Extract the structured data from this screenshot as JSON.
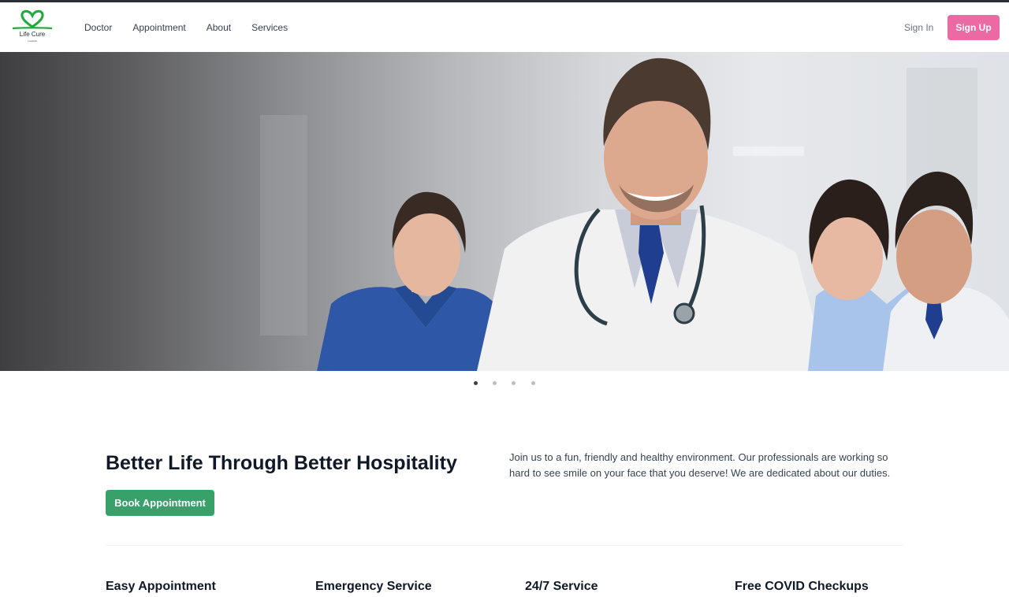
{
  "brand": {
    "name": "Life Cure",
    "tagline": "hospitals",
    "colors": {
      "heart": "#1faa3b",
      "signup": "#ec6aa4",
      "primary_button": "#38a169"
    }
  },
  "nav": {
    "links": [
      "Doctor",
      "Appointment",
      "About",
      "Services"
    ],
    "sign_in": "Sign In",
    "sign_up": "Sign Up"
  },
  "carousel": {
    "slide_count": 4,
    "active_index": 0
  },
  "intro": {
    "headline": "Better Life Through Better Hospitality",
    "cta": "Book Appointment",
    "paragraph": "Join us to a fun, friendly and healthy environment. Our professionals are working so hard to see smile on your face that you deserve! We are dedicated about our duties."
  },
  "features": [
    "Easy Appointment",
    "Emergency Service",
    "24/7 Service",
    "Free COVID Checkups"
  ]
}
